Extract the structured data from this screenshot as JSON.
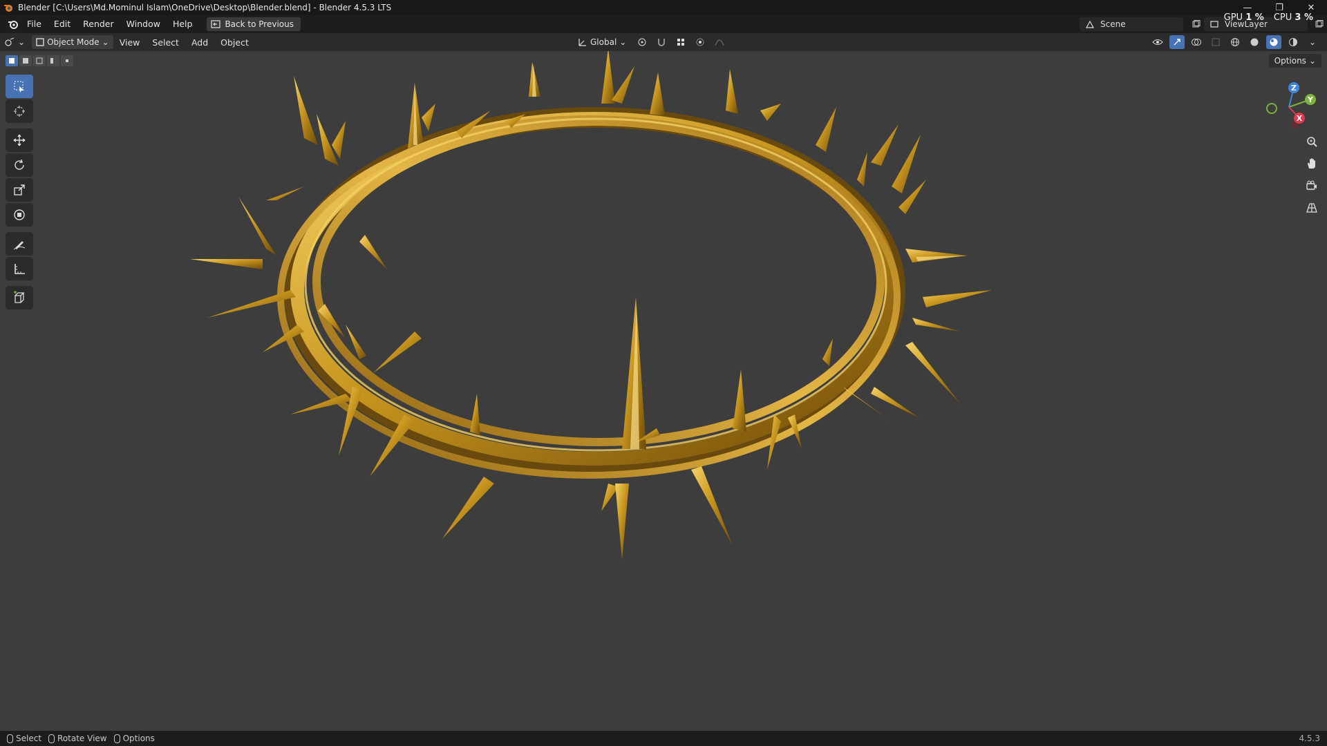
{
  "window": {
    "title": "Blender [C:\\Users\\Md.Mominul Islam\\OneDrive\\Desktop\\Blender.blend] - Blender 4.5.3 LTS",
    "minimize": "—",
    "restore": "❐",
    "close": "✕"
  },
  "menubar": {
    "items": [
      "File",
      "Edit",
      "Render",
      "Window",
      "Help"
    ],
    "back_button": "Back to Previous"
  },
  "topbar": {
    "scene": "Scene",
    "view_layer": "ViewLayer",
    "gpu_label": "GPU",
    "gpu_value": "1 %",
    "cpu_label": "CPU",
    "cpu_value": "3 %"
  },
  "header": {
    "mode": "Object Mode",
    "menus": [
      "View",
      "Select",
      "Add",
      "Object"
    ],
    "transform_orientation": "Global",
    "options": "Options"
  },
  "gizmo": {
    "z": "Z",
    "y": "Y",
    "x": "X"
  },
  "statusbar": {
    "select": "Select",
    "rotate_view": "Rotate View",
    "options": "Options",
    "version": "4.5.3"
  },
  "colors": {
    "accent": "#4772b3",
    "gold": "#c8961e",
    "viewport_bg": "#3d3d3d",
    "axis_x": "#e0384c",
    "axis_y": "#7bb339",
    "axis_z": "#3d86e0"
  }
}
